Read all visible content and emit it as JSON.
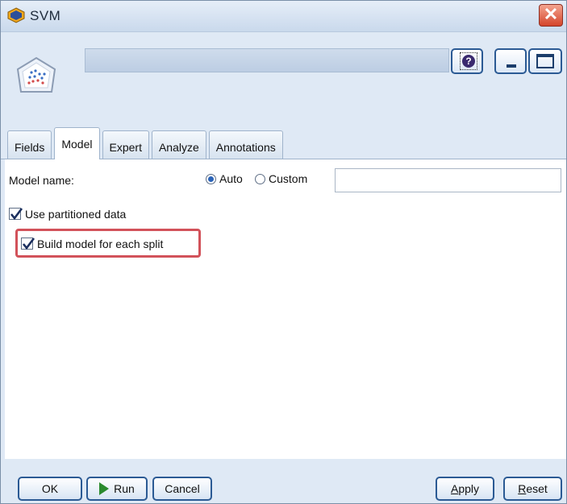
{
  "window": {
    "title": "SVM"
  },
  "tabs": [
    {
      "label": "Fields"
    },
    {
      "label": "Model"
    },
    {
      "label": "Expert"
    },
    {
      "label": "Analyze"
    },
    {
      "label": "Annotations"
    }
  ],
  "active_tab": "Model",
  "model": {
    "model_name_label": "Model name:",
    "radio_auto": "Auto",
    "radio_custom": "Custom",
    "selected": "Auto",
    "custom_name_value": "",
    "use_partitioned_label": "Use partitioned data",
    "use_partitioned_checked": true,
    "build_split_label": "Build model for each split",
    "build_split_checked": true
  },
  "buttons": {
    "ok": "OK",
    "run": "Run",
    "cancel": "Cancel",
    "apply_prefix": "A",
    "apply_rest": "pply",
    "reset_prefix": "R",
    "reset_rest": "eset"
  },
  "colors": {
    "highlight_border": "#d2525a",
    "frame_bg": "#dfe9f5",
    "button_border": "#2b5a94",
    "run_icon": "#2a8a2e"
  },
  "icons": {
    "title": "svm-node-icon",
    "model": "svm-model-icon",
    "close": "close-icon",
    "help": "help-icon",
    "minimize": "minimize-icon",
    "maximize": "maximize-icon",
    "run": "play-icon"
  }
}
